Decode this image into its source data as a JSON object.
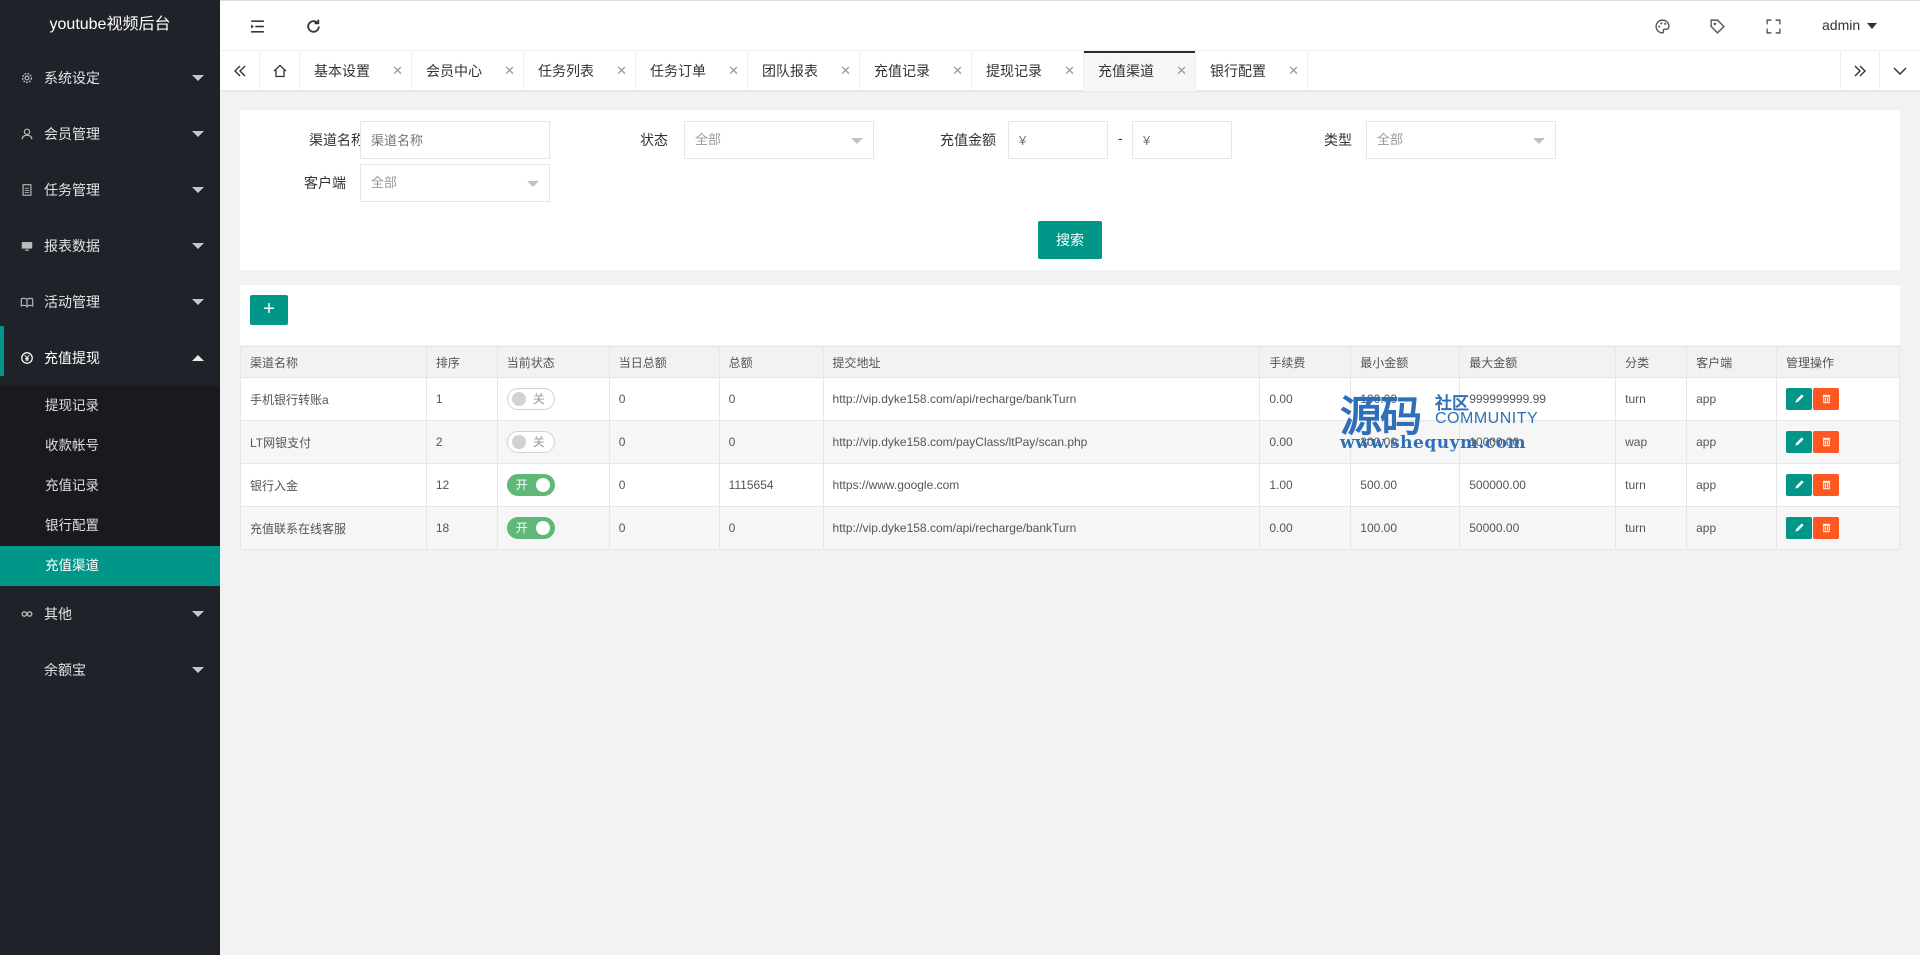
{
  "sidebar": {
    "logo": "youtube视频后台",
    "menu": [
      {
        "label": "系统设定",
        "icon": "gear-icon"
      },
      {
        "label": "会员管理",
        "icon": "user-icon"
      },
      {
        "label": "任务管理",
        "icon": "document-icon"
      },
      {
        "label": "报表数据",
        "icon": "monitor-icon"
      },
      {
        "label": "活动管理",
        "icon": "reading-icon"
      },
      {
        "label": "充值提现",
        "icon": "yen-circle-icon",
        "expanded": true
      },
      {
        "label": "其他",
        "icon": "link-icon"
      },
      {
        "label": "余额宝",
        "icon": ""
      }
    ],
    "submenu": [
      "提现记录",
      "收款帐号",
      "充值记录",
      "银行配置",
      "充值渠道"
    ],
    "active_submenu": "充值渠道"
  },
  "header": {
    "user": "admin",
    "icons": [
      "collapse-menu-icon",
      "refresh-icon",
      "theme-icon",
      "tag-icon",
      "fullscreen-icon"
    ]
  },
  "tabs": {
    "items": [
      "基本设置",
      "会员中心",
      "任务列表",
      "任务订单",
      "团队报表",
      "充值记录",
      "提现记录",
      "充值渠道",
      "银行配置"
    ],
    "active": "充值渠道",
    "close_glyph": "✕"
  },
  "search": {
    "channel_name_label": "渠道名称",
    "channel_name_placeholder": "渠道名称",
    "status_label": "状态",
    "status_value": "全部",
    "amount_label": "充值金额",
    "amount_min_placeholder": "¥",
    "amount_max_placeholder": "¥",
    "amount_separator": "-",
    "type_label": "类型",
    "type_value": "全部",
    "client_label": "客户端",
    "client_value": "全部",
    "search_button": "搜索"
  },
  "toolbar": {
    "add_label": "+"
  },
  "table": {
    "columns": [
      "渠道名称",
      "排序",
      "当前状态",
      "当日总额",
      "总额",
      "提交地址",
      "手续费",
      "最小金额",
      "最大金额",
      "分类",
      "客户端",
      "管理操作"
    ],
    "rows": [
      {
        "name": "手机银行转账a",
        "sort": "1",
        "status": "关",
        "on": false,
        "today": "0",
        "total": "0",
        "url": "http://vip.dyke158.com/api/recharge/bankTurn",
        "fee": "0.00",
        "min": "100.00",
        "max": "999999999.99",
        "category": "turn",
        "client": "app"
      },
      {
        "name": "LT网银支付",
        "sort": "2",
        "status": "关",
        "on": false,
        "today": "0",
        "total": "0",
        "url": "http://vip.dyke158.com/payClass/ltPay/scan.php",
        "fee": "0.00",
        "min": "300.00",
        "max": "10000.00",
        "category": "wap",
        "client": "app"
      },
      {
        "name": "银行入金",
        "sort": "12",
        "status": "开",
        "on": true,
        "today": "0",
        "total": "1115654",
        "url": "https://www.google.com",
        "fee": "1.00",
        "min": "500.00",
        "max": "500000.00",
        "category": "turn",
        "client": "app"
      },
      {
        "name": "充值联系在线客服",
        "sort": "18",
        "status": "开",
        "on": true,
        "today": "0",
        "total": "0",
        "url": "http://vip.dyke158.com/api/recharge/bankTurn",
        "fee": "0.00",
        "min": "100.00",
        "max": "50000.00",
        "category": "turn",
        "client": "app"
      }
    ]
  },
  "watermark": {
    "main": "源码",
    "side": "社区",
    "community": "COMMUNITY",
    "url": "www.shequym.com"
  },
  "colors": {
    "accent": "#009688",
    "sidebar_bg": "#20222a",
    "switch_on": "#5fb878",
    "danger": "#ff5722"
  }
}
